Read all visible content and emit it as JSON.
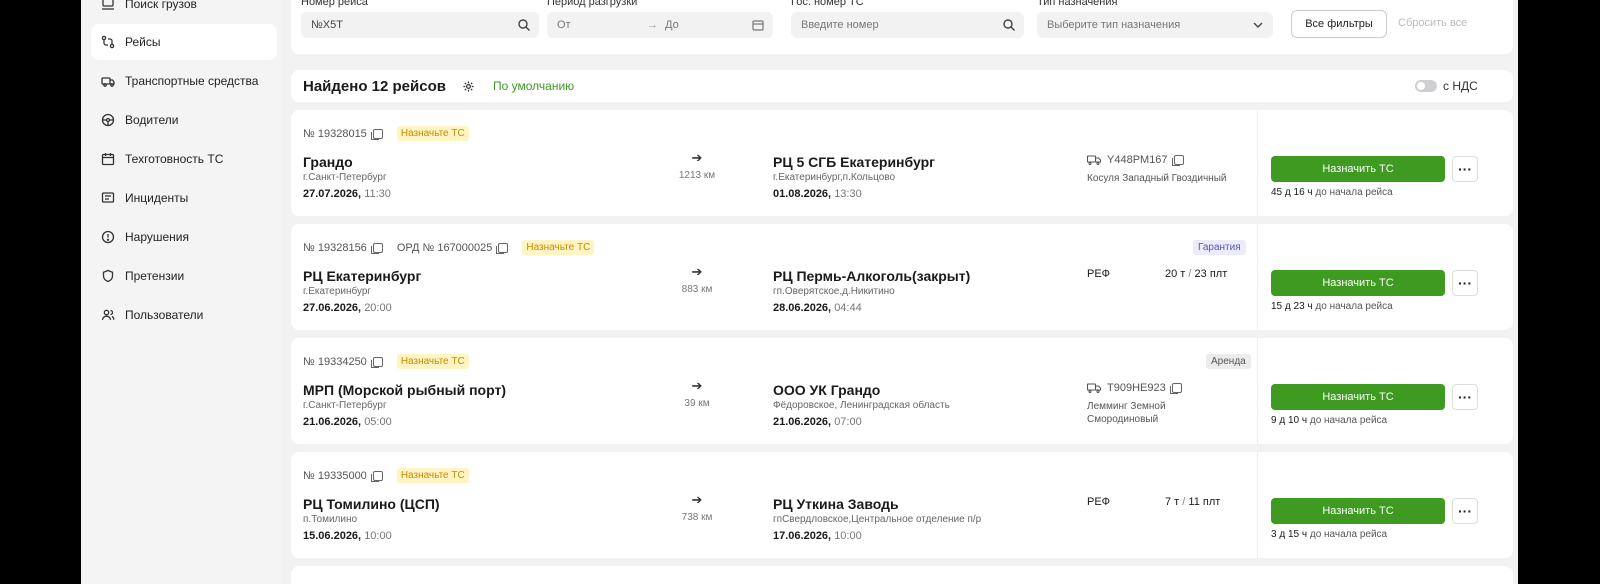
{
  "sidebar": {
    "items": [
      {
        "label": "Поиск грузов",
        "icon": "truck-cargo-icon"
      },
      {
        "label": "Рейсы",
        "icon": "route-icon",
        "active": true
      },
      {
        "label": "Транспортные средства",
        "icon": "vehicle-icon"
      },
      {
        "label": "Водители",
        "icon": "steering-wheel-icon"
      },
      {
        "label": "Техготовность ТС",
        "icon": "calendar-icon"
      },
      {
        "label": "Инциденты",
        "icon": "message-icon"
      },
      {
        "label": "Нарушения",
        "icon": "alert-circle-icon"
      },
      {
        "label": "Претензии",
        "icon": "shield-icon"
      },
      {
        "label": "Пользователи",
        "icon": "users-icon"
      }
    ]
  },
  "filters": {
    "trip_number": {
      "label": "Номер рейса",
      "value": "№X5T"
    },
    "unload_period": {
      "label": "Период разгрузки",
      "from": "От",
      "to": "До"
    },
    "plate": {
      "label": "Гос. номер ТС",
      "placeholder": "Введите номер"
    },
    "dest_type": {
      "label": "Тип назначения",
      "placeholder": "Выберите тип назначения"
    },
    "all_filters": "Все фильтры",
    "reset": "Сбросить все"
  },
  "results": {
    "found": "Найдено 12 рейсов",
    "sort": "По умолчанию",
    "vat": "с НДС"
  },
  "trips": [
    {
      "number": "№ 19328015",
      "ord": "",
      "badge": "Назначьте ТС",
      "tag": "",
      "from_name": "Грандо",
      "from_city": "г.Санкт-Петербург",
      "from_date": "27.07.2026,",
      "from_time": "11:30",
      "distance": "1213 км",
      "to_name": "РЦ 5 СГБ Екатеринбург",
      "to_city": "г.Екатеринбург,п.Кольцово",
      "to_date": "01.08.2026,",
      "to_time": "13:30",
      "plate": "Y448PM167",
      "driver": "Косуля Западный Гвоздичный",
      "type": "",
      "weight": "",
      "pallets": "",
      "assign": "Назначить ТС",
      "until_val": "45 д 16 ч",
      "until_text": "до начала рейса"
    },
    {
      "number": "№ 19328156",
      "ord": "ОРД № 167000025",
      "badge": "Назначьте ТС",
      "tag": "Гарантия",
      "from_name": "РЦ Екатеринбург",
      "from_city": "г.Екатеринбург",
      "from_date": "27.06.2026,",
      "from_time": "20:00",
      "distance": "883 км",
      "to_name": "РЦ Пермь-Алкоголь(закрыт)",
      "to_city": "гп.Оверятское,д.Никитино",
      "to_date": "28.06.2026,",
      "to_time": "04:44",
      "plate": "",
      "driver": "",
      "type": "РЕФ",
      "weight": "20 т",
      "pallets": "23 плт",
      "assign": "Назначить ТС",
      "until_val": "15 д 23 ч",
      "until_text": "до начала рейса"
    },
    {
      "number": "№ 19334250",
      "ord": "",
      "badge": "Назначьте ТС",
      "tag": "Аренда",
      "from_name": "МРП (Морской рыбный порт)",
      "from_city": "г.Санкт-Петербург",
      "from_date": "21.06.2026,",
      "from_time": "05:00",
      "distance": "39 км",
      "to_name": "ООО УК Грандо",
      "to_city": "Фёдоровское, Ленинградская область",
      "to_date": "21.06.2026,",
      "to_time": "07:00",
      "plate": "T909HE923",
      "driver": "Лемминг Земной Смородиновый",
      "type": "",
      "weight": "",
      "pallets": "",
      "assign": "Назначить ТС",
      "until_val": "9 д 10 ч",
      "until_text": "до начала рейса"
    },
    {
      "number": "№ 19335000",
      "ord": "",
      "badge": "Назначьте ТС",
      "tag": "",
      "from_name": "РЦ Томилино (ЦСП)",
      "from_city": "п.Томилино",
      "from_date": "15.06.2026,",
      "from_time": "10:00",
      "distance": "738 км",
      "to_name": "РЦ Уткина Заводь",
      "to_city": "гпСвердловское,Центральное отделение п/р",
      "to_date": "17.06.2026,",
      "to_time": "10:00",
      "plate": "",
      "driver": "",
      "type": "РЕФ",
      "weight": "7 т",
      "pallets": "11 плт",
      "assign": "Назначить ТС",
      "until_val": "3 д 15 ч",
      "until_text": "до начала рейса"
    }
  ],
  "colors": {
    "accent_green": "#3f9a22",
    "badge_yellow": "#fff4c2",
    "guarantee": "#5457b8"
  }
}
